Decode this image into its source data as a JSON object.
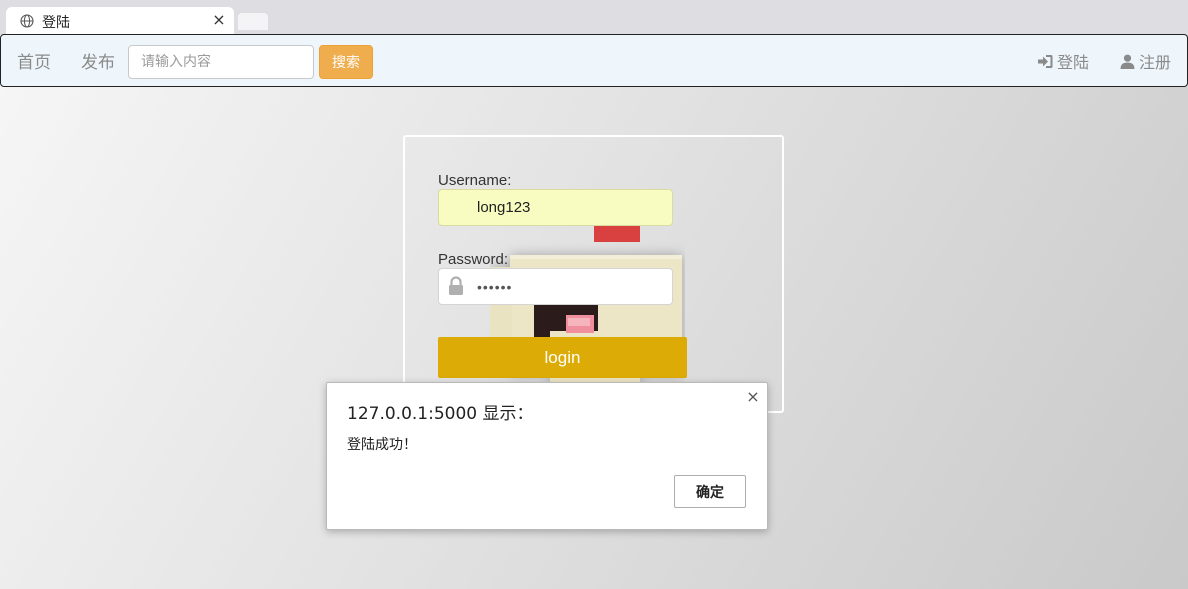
{
  "browser": {
    "tab_title": "登陆",
    "tab_close": "×"
  },
  "navbar": {
    "home": "首页",
    "publish": "发布",
    "search_placeholder": "请输入内容",
    "search_button": "搜索",
    "login": "登陆",
    "register": "注册"
  },
  "login_form": {
    "username_label": "Username:",
    "username_value": "long123",
    "password_label": "Password:",
    "password_value": "••••••",
    "submit": "login"
  },
  "alert": {
    "title": "127.0.0.1:5000 显示：",
    "message": "登陆成功！",
    "ok": "确定",
    "close": "×"
  },
  "colors": {
    "search_button": "#f0ad4e",
    "login_button": "#ddab05",
    "navbar_bg": "#eef6fc",
    "username_autofill": "#f9fcc0"
  },
  "icons": {
    "tab": "globe-icon",
    "nav_login": "sign-in-icon",
    "nav_register": "user-icon",
    "password": "lock-icon"
  }
}
